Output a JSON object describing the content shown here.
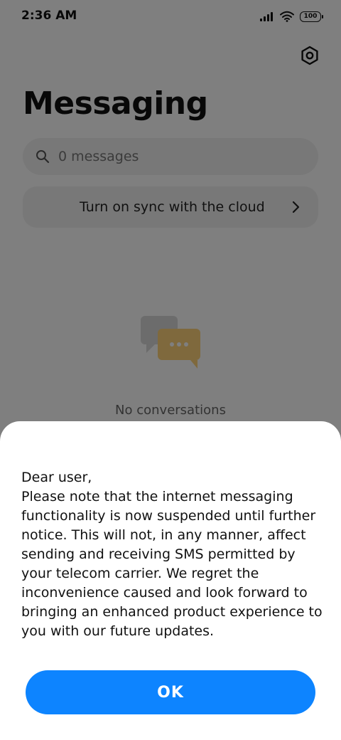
{
  "status_bar": {
    "time": "2:36 AM",
    "battery": "100",
    "icons": [
      "signal-icon",
      "wifi-icon",
      "battery-icon"
    ]
  },
  "header": {
    "title": "Messaging",
    "settings_icon": "gear-icon"
  },
  "search": {
    "placeholder": "0 messages",
    "icon": "search-icon"
  },
  "sync_banner": {
    "label": "Turn on sync with the cloud",
    "icon": "chevron-right-icon"
  },
  "empty_state": {
    "icon": "chat-bubbles-icon",
    "label": "No conversations"
  },
  "dialog": {
    "message": "Dear user,\nPlease note that the internet messaging functionality is now suspended until further notice. This will not, in any manner, affect sending and receiving SMS permitted by your telecom carrier. We regret the inconvenience caused and look forward to bringing an enhanced product experience to you with our future updates.",
    "ok_label": "OK"
  },
  "colors": {
    "accent": "#0d84ff",
    "scrim": "#000000",
    "surface": "#ffffff",
    "chip_background": "#f1f1f1"
  }
}
